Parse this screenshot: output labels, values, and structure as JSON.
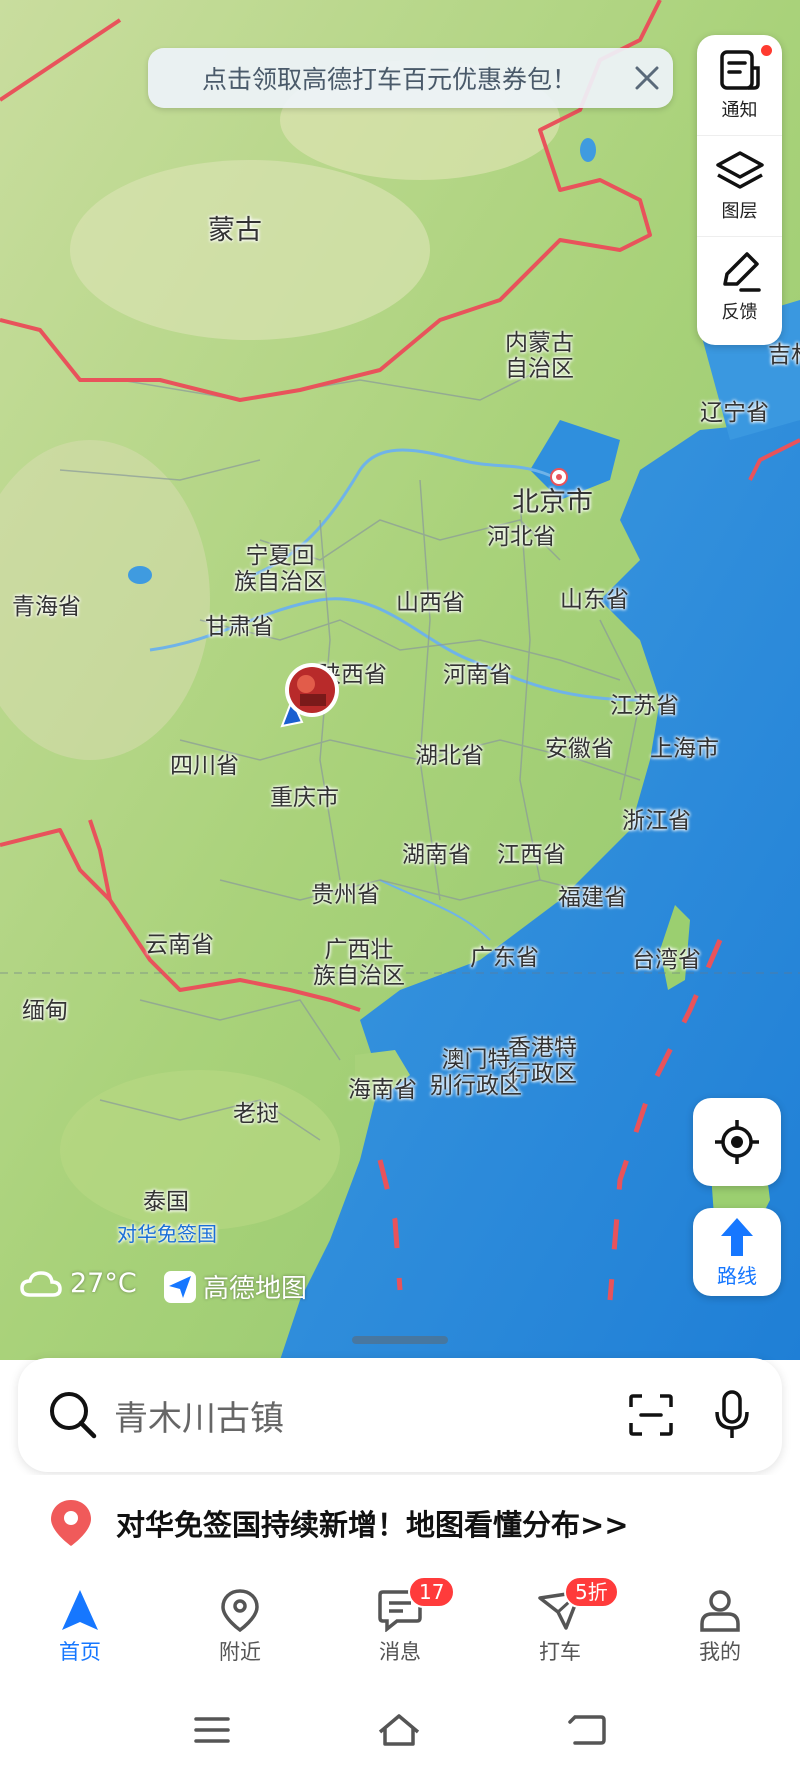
{
  "banner": {
    "text": "点击领取高德打车百元优惠券包！",
    "close_icon": "close-icon"
  },
  "toolbox": {
    "notify_label": "通知",
    "layers_label": "图层",
    "feedback_label": "反馈"
  },
  "map_labels": [
    {
      "key": "mongolia",
      "text": "蒙古"
    },
    {
      "key": "inner_mongolia",
      "text": "内蒙古\n自治区"
    },
    {
      "key": "jilin",
      "text": "吉林"
    },
    {
      "key": "liaoning",
      "text": "辽宁省"
    },
    {
      "key": "beijing",
      "text": "北京市"
    },
    {
      "key": "hebei",
      "text": "河北省"
    },
    {
      "key": "ningxia",
      "text": "宁夏回\n族自治区"
    },
    {
      "key": "qinghai",
      "text": "青海省"
    },
    {
      "key": "gansu",
      "text": "甘肃省"
    },
    {
      "key": "shanxi",
      "text": "山西省"
    },
    {
      "key": "shandong",
      "text": "山东省"
    },
    {
      "key": "shaanxi",
      "text": "陕西省"
    },
    {
      "key": "henan",
      "text": "河南省"
    },
    {
      "key": "jiangsu",
      "text": "江苏省"
    },
    {
      "key": "sichuan",
      "text": "四川省"
    },
    {
      "key": "hubei",
      "text": "湖北省"
    },
    {
      "key": "anhui",
      "text": "安徽省"
    },
    {
      "key": "shanghai",
      "text": "上海市"
    },
    {
      "key": "chongqing",
      "text": "重庆市"
    },
    {
      "key": "zhejiang",
      "text": "浙江省"
    },
    {
      "key": "hunan",
      "text": "湖南省"
    },
    {
      "key": "jiangxi",
      "text": "江西省"
    },
    {
      "key": "guizhou",
      "text": "贵州省"
    },
    {
      "key": "fujian",
      "text": "福建省"
    },
    {
      "key": "yunnan",
      "text": "云南省"
    },
    {
      "key": "guangxi",
      "text": "广西壮\n族自治区"
    },
    {
      "key": "guangdong",
      "text": "广东省"
    },
    {
      "key": "taiwan",
      "text": "台湾省"
    },
    {
      "key": "myanmar",
      "text": "缅甸"
    },
    {
      "key": "macau",
      "text": "澳门特\n别行政区"
    },
    {
      "key": "hongkong",
      "text": "香港特\n行政区"
    },
    {
      "key": "hainan",
      "text": "海南省"
    },
    {
      "key": "laos",
      "text": "老挝"
    },
    {
      "key": "thailand",
      "text": "泰国"
    },
    {
      "key": "visa_free",
      "text": "对华免签国"
    }
  ],
  "weather": {
    "temp": "27°C",
    "icon": "cloud-icon"
  },
  "brand": {
    "name": "高德地图"
  },
  "locate_icon": "locate-icon",
  "route": {
    "label": "路线"
  },
  "search": {
    "placeholder": "青木川古镇"
  },
  "promo": {
    "text": "对华免签国持续新增！地图看懂分布>>"
  },
  "tabs": [
    {
      "label": "首页",
      "icon": "navigation-arrow-icon",
      "active": true
    },
    {
      "label": "附近",
      "icon": "location-pin-icon"
    },
    {
      "label": "消息",
      "icon": "message-icon",
      "badge": "17"
    },
    {
      "label": "打车",
      "icon": "taxi-icon",
      "badge": "5折"
    },
    {
      "label": "我的",
      "icon": "person-icon"
    }
  ],
  "colors": {
    "accent": "#1677ff",
    "badge": "#ff3b3b",
    "border": "#e8535b"
  }
}
